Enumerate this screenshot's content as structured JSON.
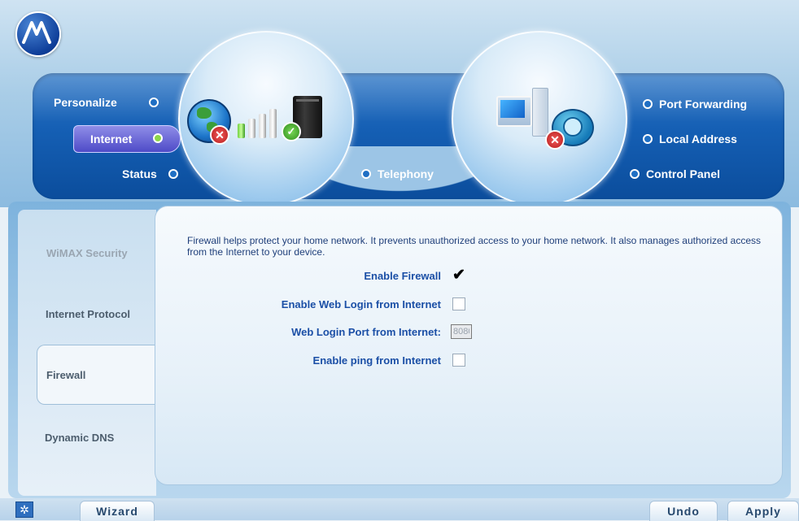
{
  "brand": {
    "logo_icon": "motorola-logo-icon"
  },
  "nav": {
    "left": [
      {
        "label": "Personalize",
        "active": false
      },
      {
        "label": "Internet",
        "active": true
      },
      {
        "label": "Status",
        "active": false
      }
    ],
    "center": {
      "label": "Telephony"
    },
    "right": [
      {
        "label": "Port Forwarding"
      },
      {
        "label": "Local Address"
      },
      {
        "label": "Control Panel"
      }
    ]
  },
  "sidebar": {
    "items": [
      {
        "label": "WiMAX Security"
      },
      {
        "label": "Internet Protocol"
      },
      {
        "label": "Firewall",
        "selected": true
      },
      {
        "label": "Dynamic DNS"
      }
    ]
  },
  "firewall": {
    "description": "Firewall helps protect your home network. It prevents unauthorized access to your home network. It also manages authorized access from the Internet to your device.",
    "enable_firewall": {
      "label": "Enable Firewall",
      "checked": true
    },
    "enable_web_login": {
      "label": "Enable Web Login from Internet",
      "checked": false
    },
    "web_login_port": {
      "label": "Web Login Port from Internet:",
      "value": "8080"
    },
    "enable_ping": {
      "label": "Enable ping from Internet",
      "checked": false
    }
  },
  "footer": {
    "wizard_label": "Wizard",
    "undo_label": "Undo",
    "apply_label": "Apply"
  },
  "colors": {
    "accent_blue": "#155fb4",
    "active_green": "#8cd64a",
    "label_blue": "#1b4fa6"
  }
}
